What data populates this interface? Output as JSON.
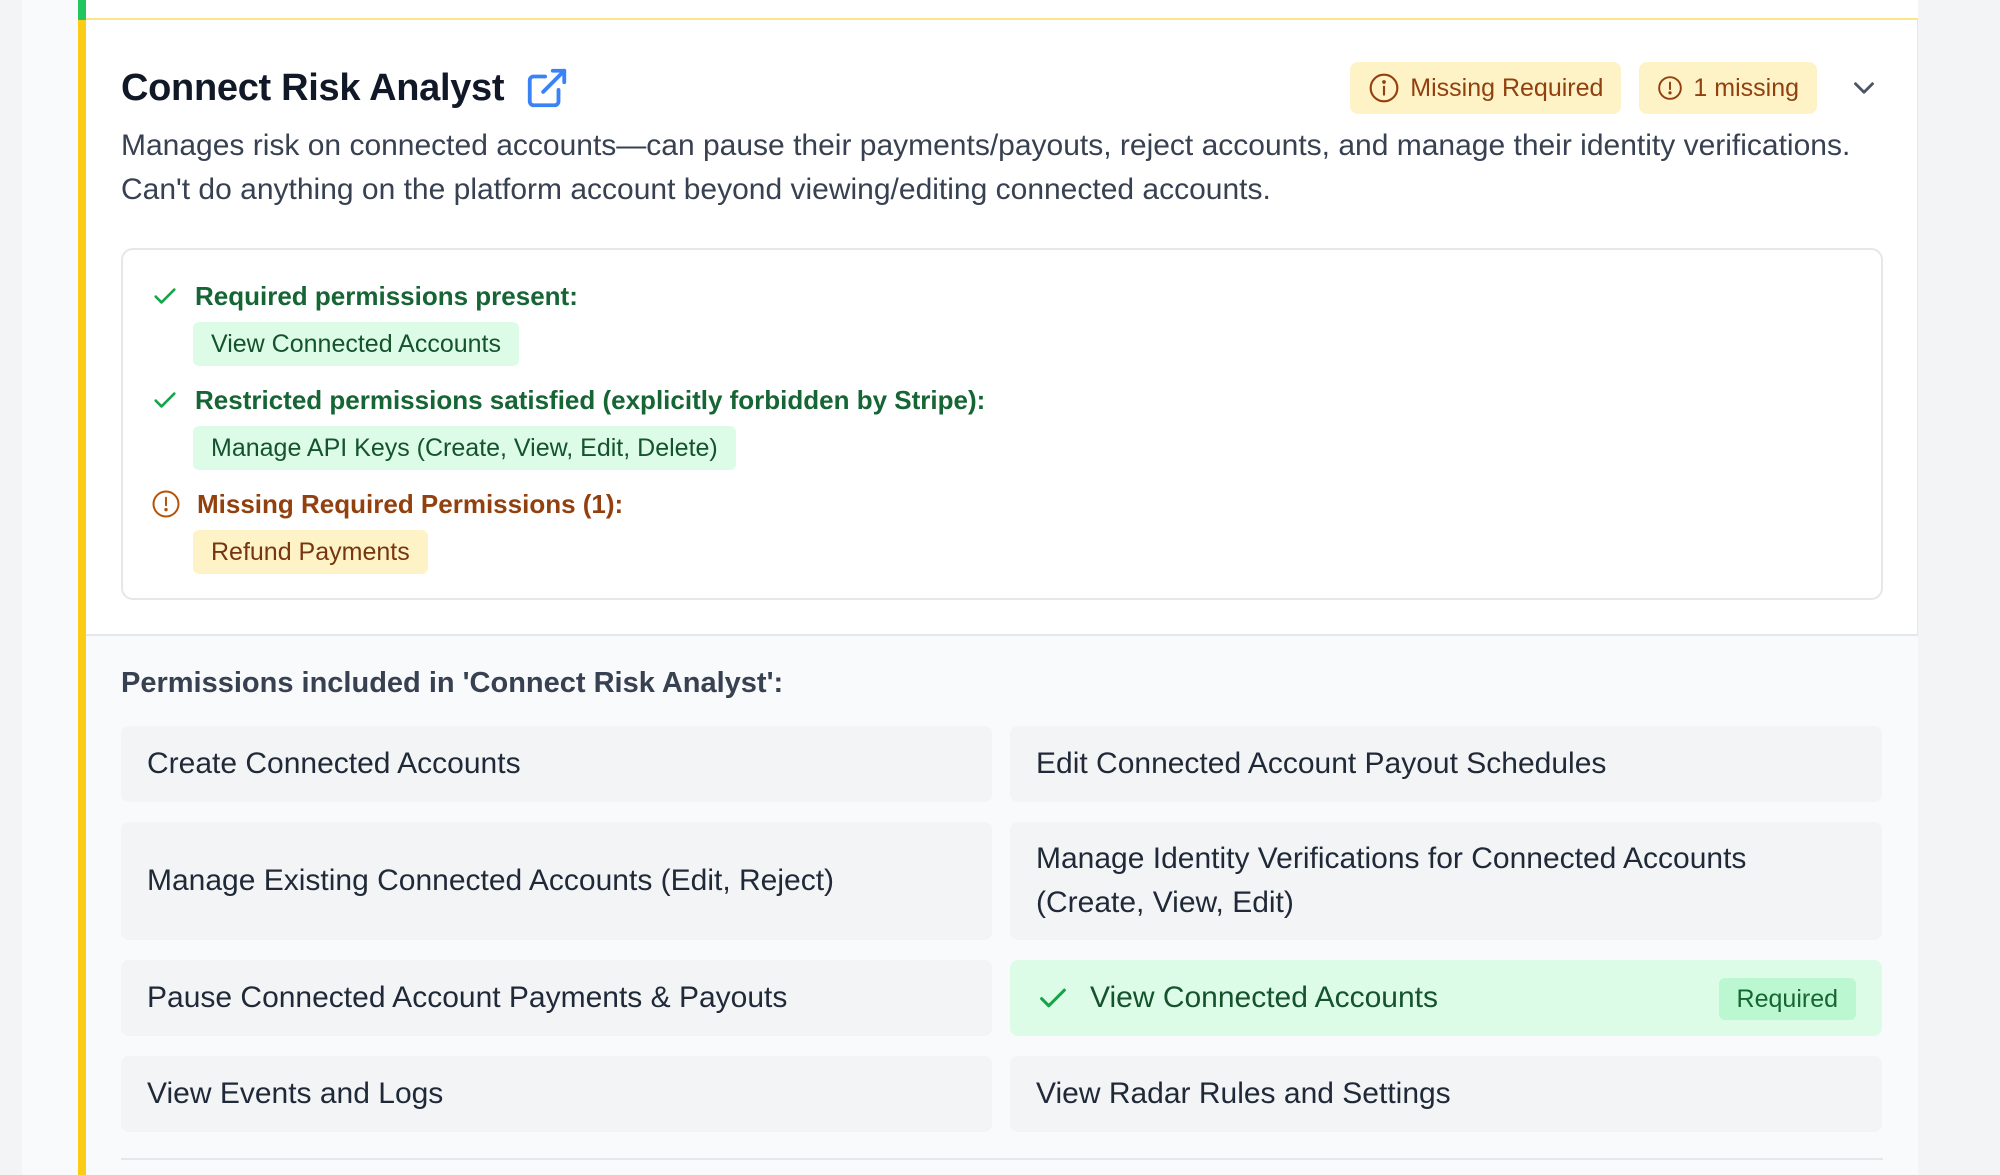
{
  "role": {
    "title": "Connect Risk Analyst",
    "description": "Manages risk on connected accounts—can pause their payments/payouts, reject accounts, and manage their identity verifications. Can't do anything on the platform account beyond viewing/editing connected accounts.",
    "badges": {
      "missing_required": "Missing Required",
      "missing_count": "1 missing"
    }
  },
  "checks": {
    "required_present": {
      "label": "Required permissions present:",
      "items": [
        "View Connected Accounts"
      ]
    },
    "restricted_satisfied": {
      "label": "Restricted permissions satisfied (explicitly forbidden by Stripe):",
      "items": [
        "Manage API Keys (Create, View, Edit, Delete)"
      ]
    },
    "missing_required": {
      "label": "Missing Required Permissions (1):",
      "items": [
        "Refund Payments"
      ]
    }
  },
  "permissions": {
    "heading": "Permissions included in 'Connect Risk Analyst':",
    "items": [
      {
        "label": "Create Connected Accounts"
      },
      {
        "label": "Edit Connected Account Payout Schedules"
      },
      {
        "label": "Manage Existing Connected Accounts (Edit, Reject)"
      },
      {
        "label": "Manage Identity Verifications for Connected Accounts (Create, View, Edit)"
      },
      {
        "label": "Pause Connected Account Payments & Payouts"
      },
      {
        "label": "View Connected Accounts",
        "tag": "Required"
      },
      {
        "label": "View Events and Logs"
      },
      {
        "label": "View Radar Rules and Settings"
      }
    ]
  },
  "colors": {
    "accent_blue": "#3b82f6",
    "warning_yellow": "#facc15",
    "success_green": "#22c55e"
  },
  "icons": {
    "external": "external-link-icon",
    "info": "info-icon",
    "alert": "alert-circle-icon",
    "chevron": "chevron-down-icon",
    "check": "check-icon"
  }
}
